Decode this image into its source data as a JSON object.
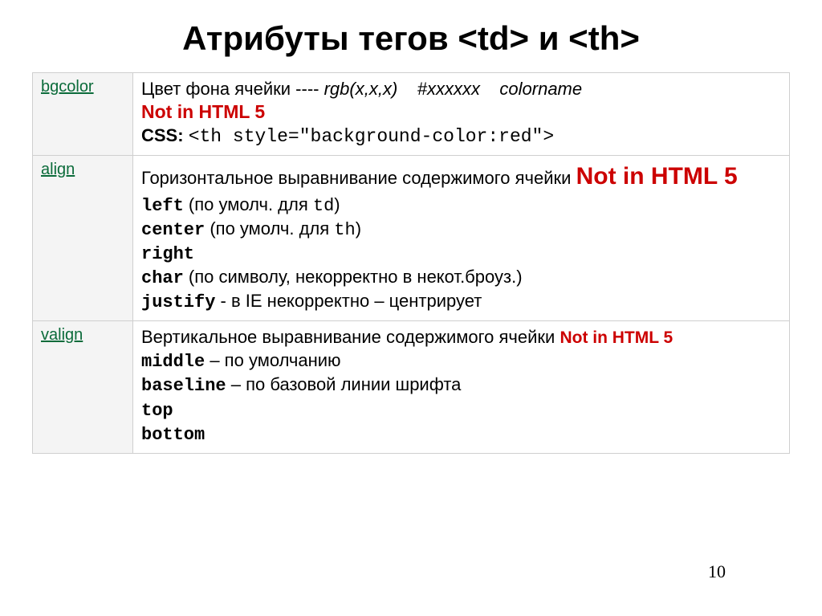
{
  "title": "Атрибуты тегов <td> и <th>",
  "page_number": "10",
  "rows": {
    "bgcolor": {
      "key": "bgcolor",
      "d_prefix": "Цвет фона ячейки ---- ",
      "d_rgb": "rgb(x,x,x)    #xxxxxx    colorname",
      "not5": "Not in HTML 5",
      "css_label": "CSS: ",
      "css_code": "<th style=\"background-color:red\">"
    },
    "align": {
      "key": "align",
      "d_prefix": "Горизонтальное выравнивание содержимого ячейки ",
      "not5": "Not in HTML 5",
      "left_kw": "left",
      "left_txt": " (по умолч. для ",
      "left_for": "td",
      "center_kw": "center",
      "center_txt": " (по умолч. для ",
      "center_for": "th",
      "right_kw": "right",
      "char_kw": "char",
      "char_txt": " (по символу, некорректно в некот.броуз.)",
      "justify_kw": "justify",
      "justify_txt": " - в IE некорректно – центрирует"
    },
    "valign": {
      "key": "valign",
      "d_prefix": "Вертикальное выравнивание содержимого ячейки ",
      "not5": "Not in HTML 5",
      "middle_kw": "middle",
      "middle_txt": " – по умолчанию",
      "baseline_kw": "baseline",
      "baseline_txt": " – по базовой линии шрифта",
      "top_kw": "top",
      "bottom_kw": "bottom"
    }
  }
}
